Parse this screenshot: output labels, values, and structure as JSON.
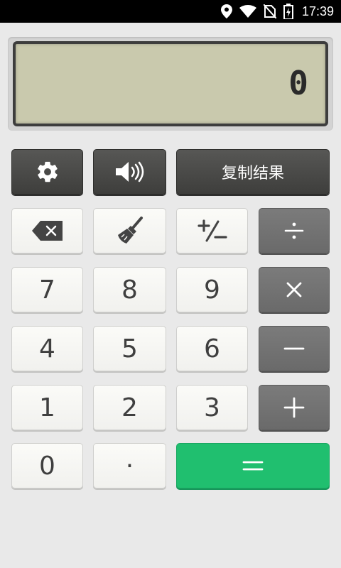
{
  "status_bar": {
    "time": "17:39",
    "icons": [
      "location-icon",
      "wifi-icon",
      "no-sim-icon",
      "battery-charging-icon"
    ]
  },
  "display": {
    "value": "0"
  },
  "top_row": {
    "settings_icon": "gear-icon",
    "sound_icon": "speaker-icon",
    "copy_label": "复制结果"
  },
  "keys": {
    "backspace_icon": "backspace-icon",
    "clear_icon": "broom-icon",
    "sign_icon": "plus-minus-icon",
    "divide_icon": "divide-icon",
    "multiply_icon": "multiply-icon",
    "minus_icon": "minus-icon",
    "plus_icon": "plus-icon",
    "equals_icon": "equals-icon",
    "seven": "7",
    "eight": "8",
    "nine": "9",
    "four": "4",
    "five": "5",
    "six": "6",
    "one": "1",
    "two": "2",
    "three": "3",
    "zero": "0",
    "point": "·"
  },
  "colors": {
    "equals_key": "#20bf6f",
    "operator_key": "#6f6f6f",
    "function_key": "#4a4a48",
    "lcd": "#c9c9ad"
  }
}
